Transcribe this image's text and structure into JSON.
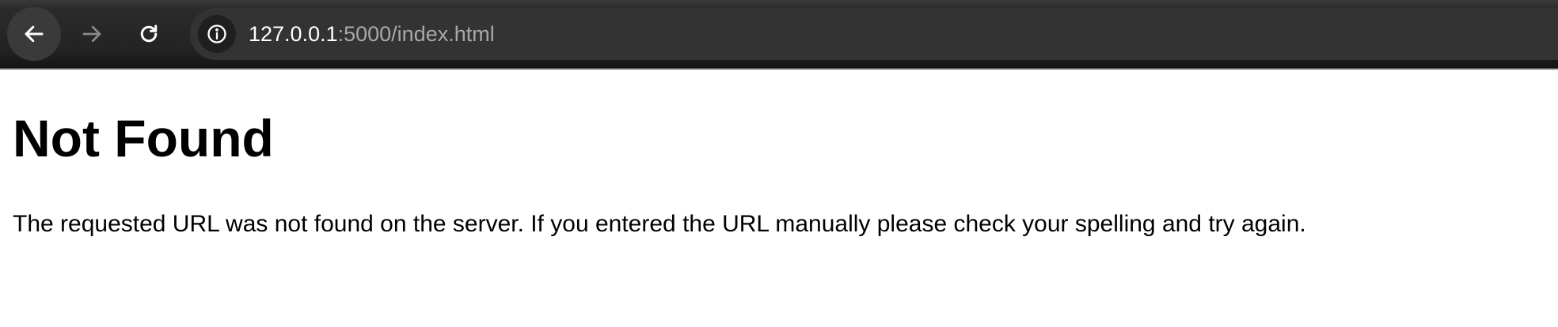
{
  "browser": {
    "toolbar": {
      "back_icon": "arrow-left-icon",
      "forward_icon": "arrow-right-icon",
      "reload_icon": "reload-icon",
      "site_info_icon": "info-icon"
    },
    "address_bar": {
      "host": "127.0.0.1",
      "rest": ":5000/index.html"
    }
  },
  "page": {
    "heading": "Not Found",
    "message": "The requested URL was not found on the server. If you entered the URL manually please check your spelling and try again."
  },
  "colors": {
    "toolbar_bg": "#232323",
    "omnibox_bg": "#333333",
    "url_host": "#ffffff",
    "url_rest": "#a8a8a8",
    "page_bg": "#ffffff",
    "text": "#000000"
  }
}
